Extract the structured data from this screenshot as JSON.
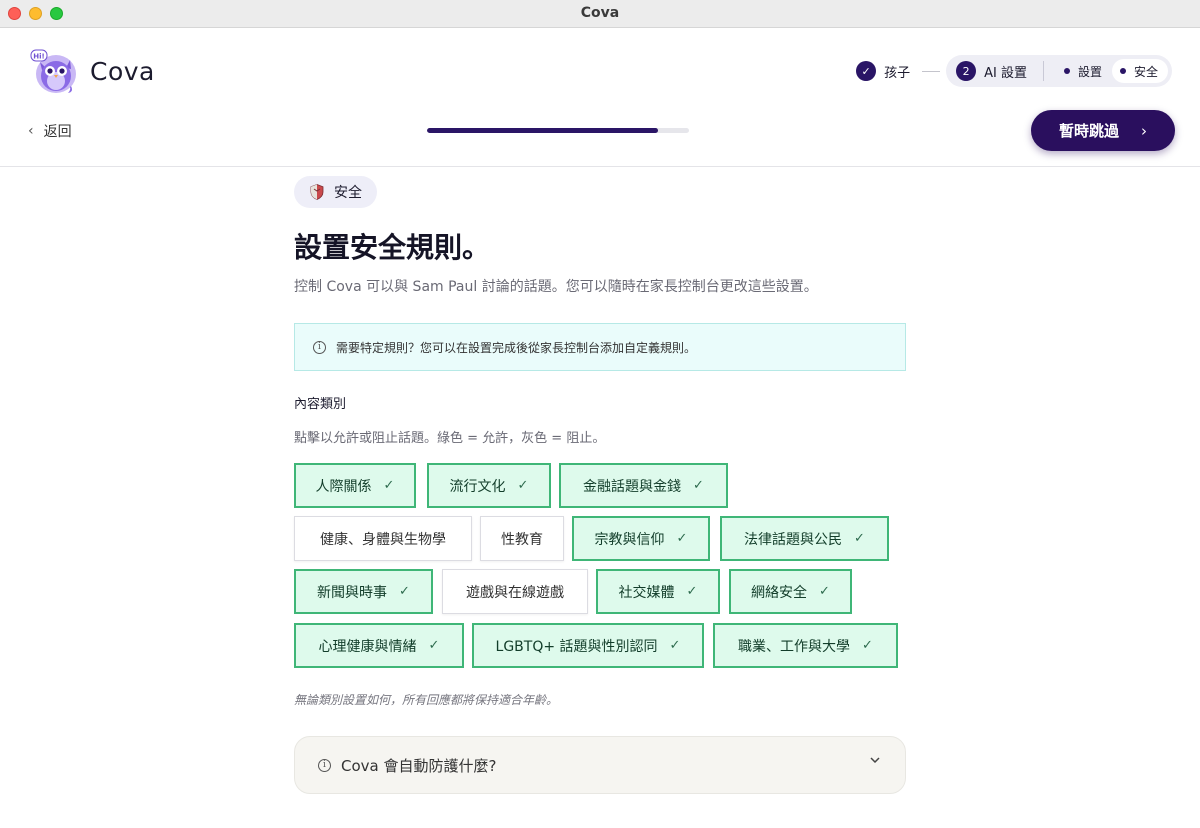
{
  "window": {
    "title": "Cova"
  },
  "header": {
    "brand": "Cova",
    "logo_badge": "Hi!",
    "back_label": "返回",
    "skip_label": "暫時跳過",
    "progress": 0.88
  },
  "stepper": {
    "step1_label": "孩子",
    "step2_number": "2",
    "step2_label": "AI 設置",
    "sub_steps": [
      {
        "label": "設置",
        "active": false
      },
      {
        "label": "安全",
        "active": true
      }
    ]
  },
  "content": {
    "badge_label": "安全",
    "heading": "設置安全規則。",
    "subtitle": "控制 Cova 可以與 Sam Paul 討論的話題。您可以隨時在家長控制台更改這些設置。",
    "info": "需要特定規則？您可以在設置完成後從家長控制台添加自定義規則。",
    "section_title": "內容類別",
    "section_help": "點擊以允許或阻止話題。綠色 = 允許，灰色 = 阻止。",
    "categories": [
      {
        "label": "人際關係",
        "allowed": true
      },
      {
        "label": "流行文化",
        "allowed": true
      },
      {
        "label": "金融話題與金錢",
        "allowed": true
      },
      {
        "label": "健康、身體與生物學",
        "allowed": false
      },
      {
        "label": "性教育",
        "allowed": false
      },
      {
        "label": "宗教與信仰",
        "allowed": true
      },
      {
        "label": "法律話題與公民",
        "allowed": true
      },
      {
        "label": "新聞與時事",
        "allowed": true
      },
      {
        "label": "遊戲與在線遊戲",
        "allowed": false
      },
      {
        "label": "社交媒體",
        "allowed": true
      },
      {
        "label": "網絡安全",
        "allowed": true
      },
      {
        "label": "心理健康與情緒",
        "allowed": true
      },
      {
        "label": "LGBTQ+ 話題與性別認同",
        "allowed": true
      },
      {
        "label": "職業、工作與大學",
        "allowed": true
      }
    ],
    "footnote": "無論類別設置如何，所有回應都將保持適合年齡。",
    "accordion_label": "Cova 會自動防護什麼?"
  },
  "icons": {
    "check": "check-icon",
    "info": "info-icon",
    "shield": "shield-icon",
    "owl": "owl-logo-icon"
  },
  "colors": {
    "primary": "#2a1566",
    "allowed_bg": "#defaec",
    "allowed_border": "#3fb677",
    "info_bg": "#eafcfb"
  }
}
